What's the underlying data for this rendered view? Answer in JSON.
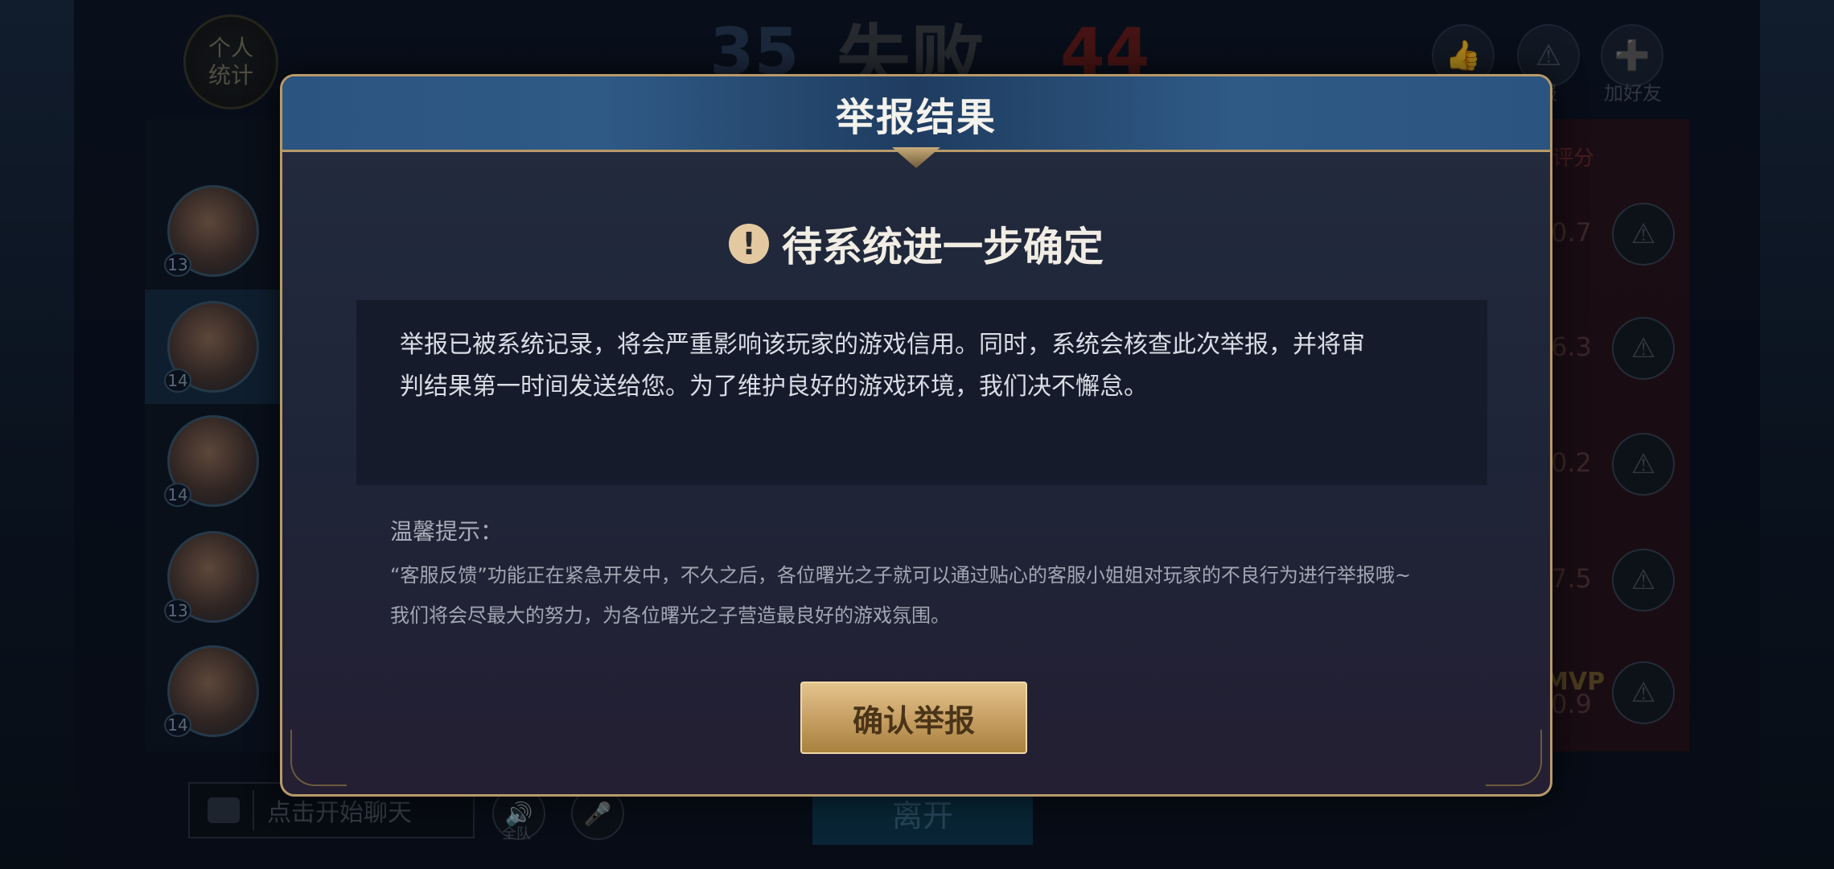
{
  "background": {
    "personal_stats": [
      "个人",
      "统计"
    ],
    "score_left": "35",
    "result": "失败",
    "score_right": "44",
    "rating_label": "评分",
    "add_friend": "加好友",
    "report_label": "报",
    "ratings": [
      "0.7",
      "6.3",
      "0.2",
      "7.5",
      "0.9"
    ],
    "hero_levels": [
      "13",
      "14",
      "14",
      "13",
      "14"
    ],
    "mvp": "MVP",
    "chat_placeholder": "点击开始聊天",
    "voice_label": "全队",
    "leave": "离开"
  },
  "dialog": {
    "title": "举报结果",
    "status": "待系统进一步确定",
    "info_lines": [
      "举报已被系统记录，将会严重影响该玩家的游戏信用。同时，系统会核查此次举报，并将审",
      "判结果第一时间发送给您。为了维护良好的游戏环境，我们决不懈怠。"
    ],
    "tip_title": "温馨提示：",
    "tip_lines": [
      "“客服反馈”功能正在紧急开发中，不久之后，各位曙光之子就可以通过贴心的客服小姐姐对玩家的不良行为进行举报哦~",
      "我们将会尽最大的努力，为各位曙光之子营造最良好的游戏氛围。"
    ],
    "confirm": "确认举报"
  },
  "colors": {
    "accent_gold": "#c8a066",
    "header_blue": "#2c5480"
  }
}
